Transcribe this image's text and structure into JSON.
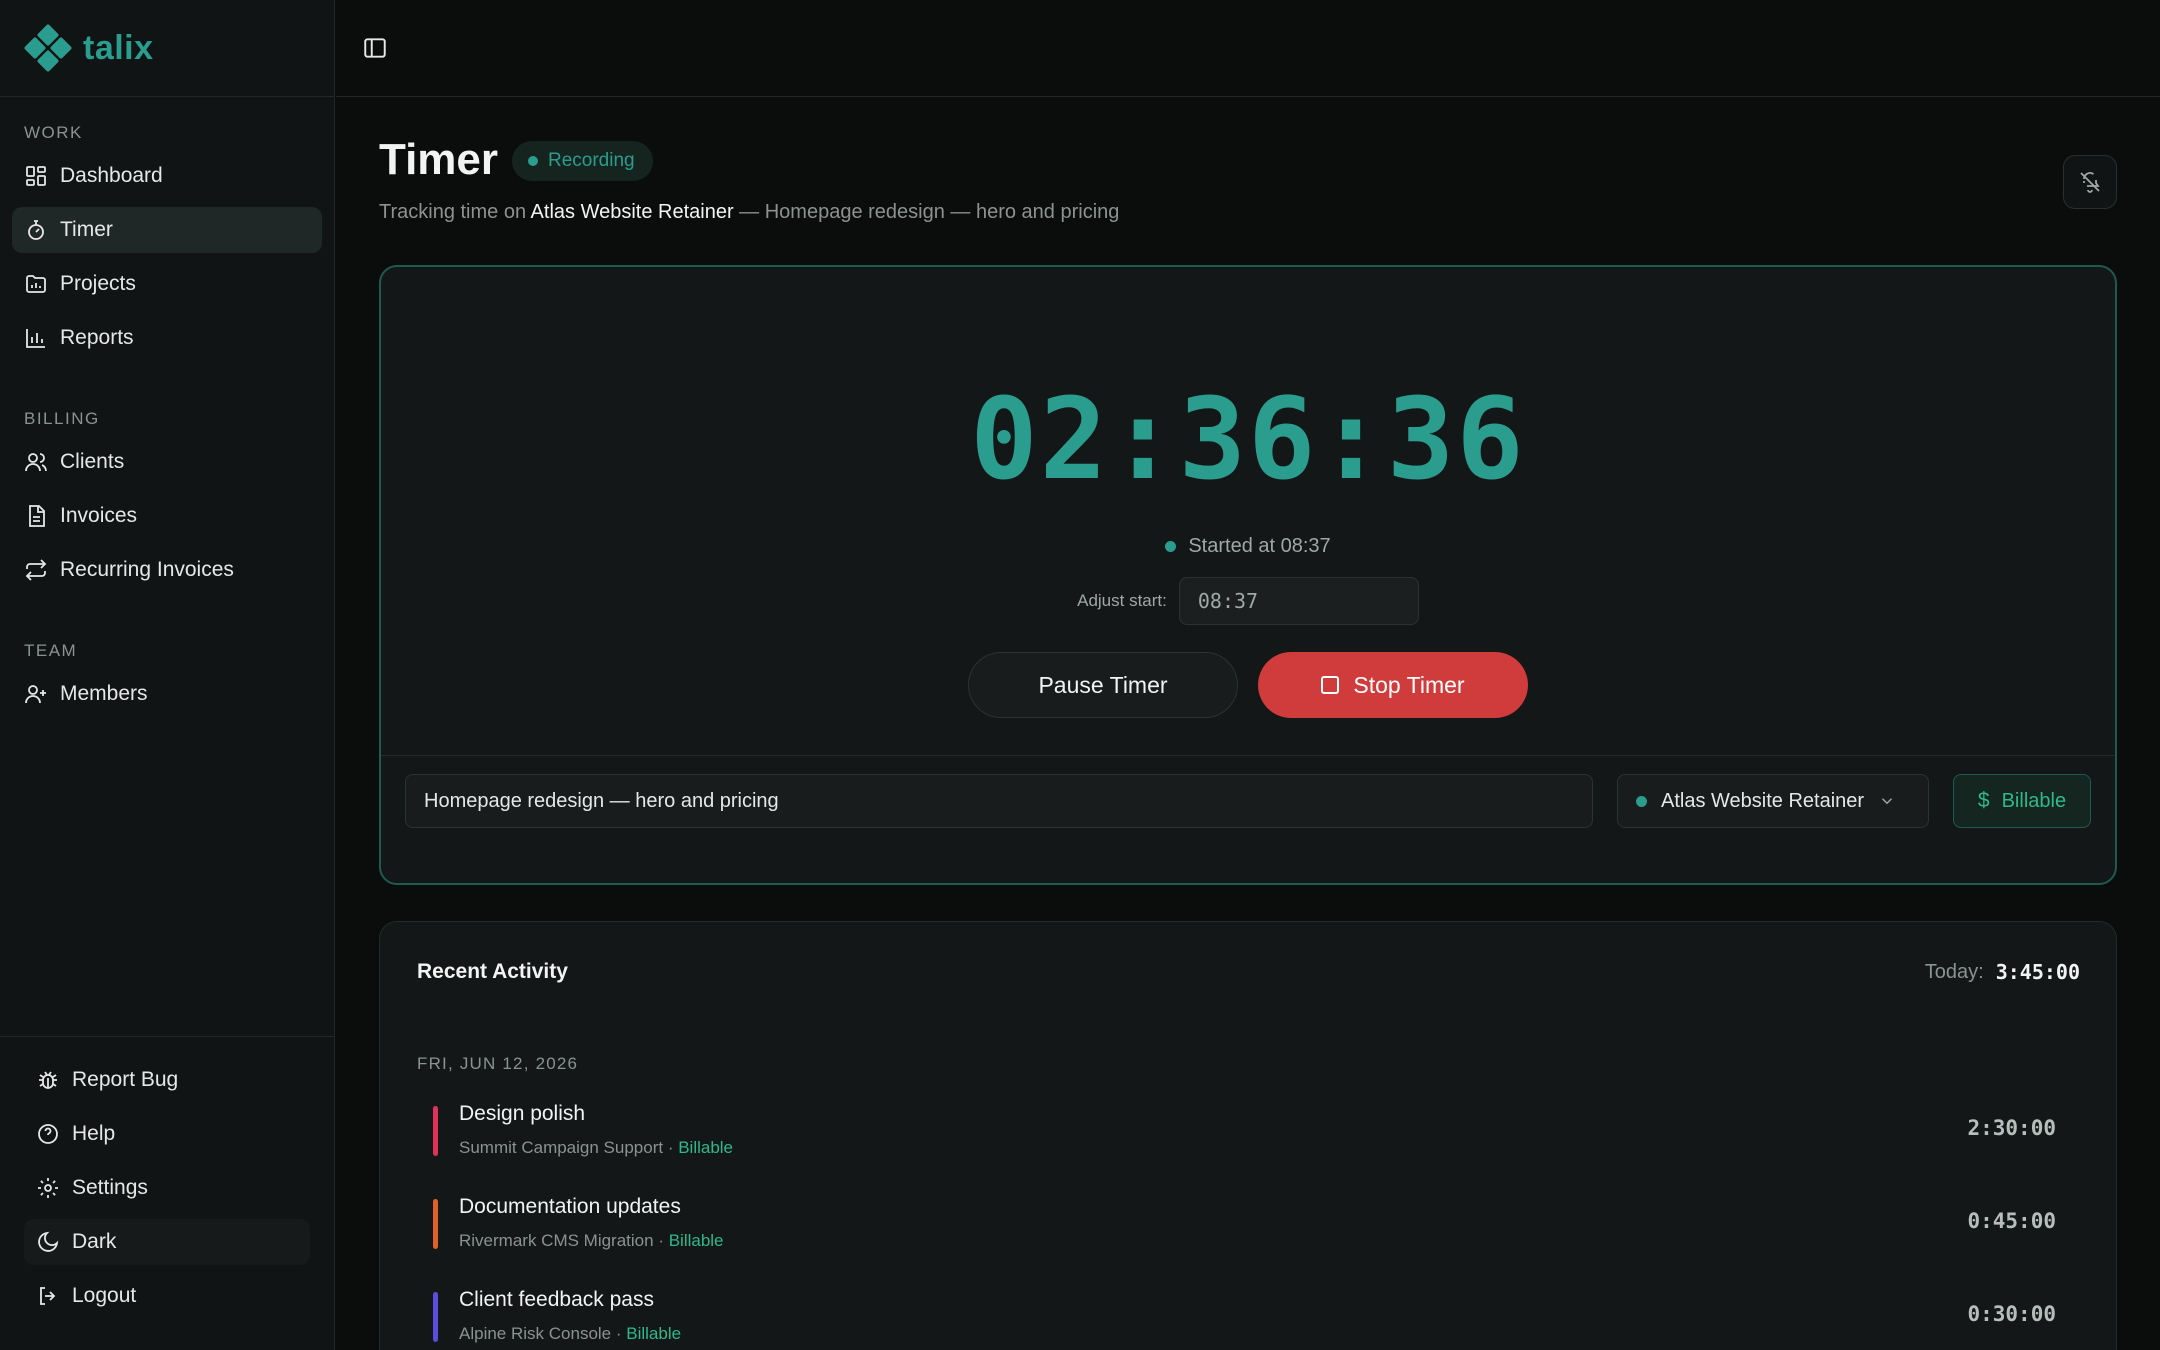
{
  "brand": {
    "name": "talix",
    "accent": "#2a9d8f"
  },
  "sidebar": {
    "sections": [
      {
        "label": "WORK",
        "items": [
          {
            "label": "Dashboard",
            "icon": "dashboard-icon"
          },
          {
            "label": "Timer",
            "icon": "timer-icon",
            "active": true
          },
          {
            "label": "Projects",
            "icon": "projects-icon"
          },
          {
            "label": "Reports",
            "icon": "reports-icon"
          }
        ]
      },
      {
        "label": "BILLING",
        "items": [
          {
            "label": "Clients",
            "icon": "clients-icon"
          },
          {
            "label": "Invoices",
            "icon": "invoices-icon"
          },
          {
            "label": "Recurring Invoices",
            "icon": "recurring-icon"
          }
        ]
      },
      {
        "label": "TEAM",
        "items": [
          {
            "label": "Members",
            "icon": "members-icon"
          }
        ]
      }
    ],
    "bottom": [
      {
        "label": "Report Bug",
        "icon": "bug-icon"
      },
      {
        "label": "Help",
        "icon": "help-icon"
      },
      {
        "label": "Settings",
        "icon": "gear-icon"
      },
      {
        "label": "Dark",
        "icon": "moon-icon"
      },
      {
        "label": "Logout",
        "icon": "logout-icon"
      }
    ]
  },
  "page": {
    "title": "Timer",
    "badge": "Recording",
    "subtitle_prefix": "Tracking time on",
    "subtitle_project": "Atlas Website Retainer",
    "subtitle_suffix": "— Homepage redesign — hero and pricing"
  },
  "timer": {
    "elapsed": "02:36:36",
    "started_text": "Started at 08:37",
    "adjust_label": "Adjust start:",
    "adjust_value": "08:37",
    "pause_label": "Pause Timer",
    "stop_label": "Stop Timer",
    "description": "Homepage redesign — hero and pricing",
    "project": "Atlas Website Retainer",
    "billable_label": "Billable",
    "colors": {
      "stop": "#d03b3b",
      "billable": "#2fb98a"
    }
  },
  "activity": {
    "title": "Recent Activity",
    "today_label": "Today:",
    "today_total": "3:45:00",
    "date": "FRI, JUN 12, 2026",
    "entries": [
      {
        "name": "Design polish",
        "project": "Summit Campaign Support",
        "sep": " · ",
        "billable": "Billable",
        "duration": "2:30:00",
        "color": "#e0315b"
      },
      {
        "name": "Documentation updates",
        "project": "Rivermark CMS Migration",
        "sep": " · ",
        "billable": "Billable",
        "duration": "0:45:00",
        "color": "#e0622a"
      },
      {
        "name": "Client feedback pass",
        "project": "Alpine Risk Console",
        "sep": " · ",
        "billable": "Billable",
        "duration": "0:30:00",
        "color": "#5b4de0"
      }
    ]
  }
}
